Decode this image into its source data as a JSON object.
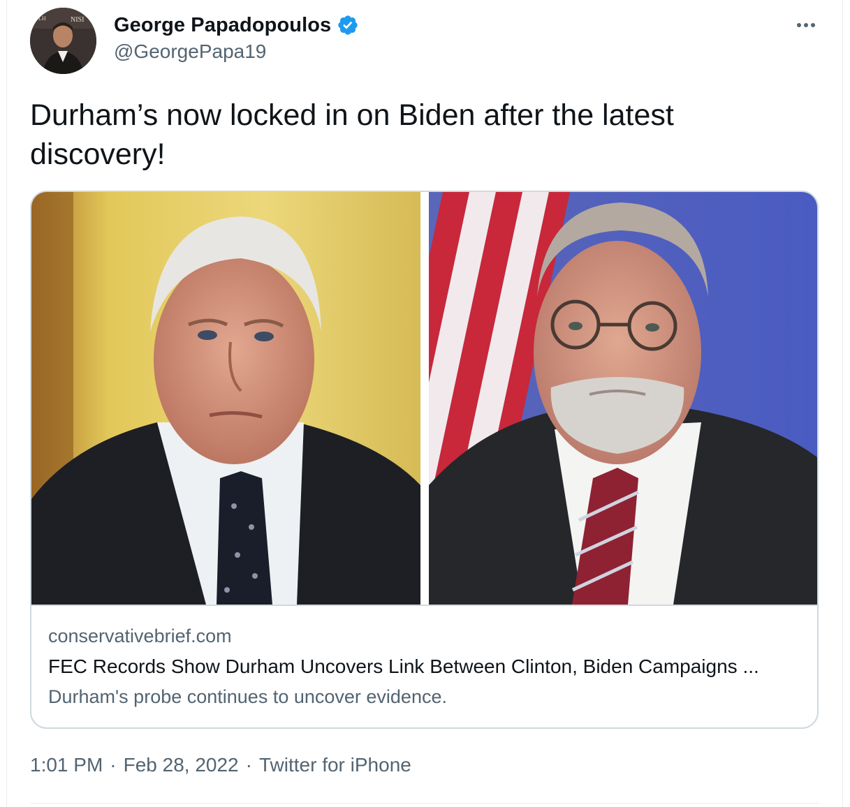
{
  "author": {
    "display_name": "George Papadopoulos",
    "handle": "@GeorgePapa19",
    "verified": true,
    "avatar_icon": "profile-photo"
  },
  "tweet": {
    "text": "Durham’s now locked in on Biden after the latest discovery!"
  },
  "card": {
    "domain": "conservativebrief.com",
    "title": "FEC Records Show Durham Uncovers Link Between Clinton, Biden Campaigns ...",
    "description": "Durham's probe continues to uncover evidence.",
    "images": [
      "biden-portrait-photo",
      "durham-portrait-photo"
    ]
  },
  "meta": {
    "time": "1:01 PM",
    "separator": "·",
    "date": "Feb 28, 2022",
    "source": "Twitter for iPhone"
  },
  "colors": {
    "text_primary": "#0f1419",
    "text_secondary": "#536471",
    "verified_blue": "#1d9bf0",
    "border": "#cfd9de"
  }
}
